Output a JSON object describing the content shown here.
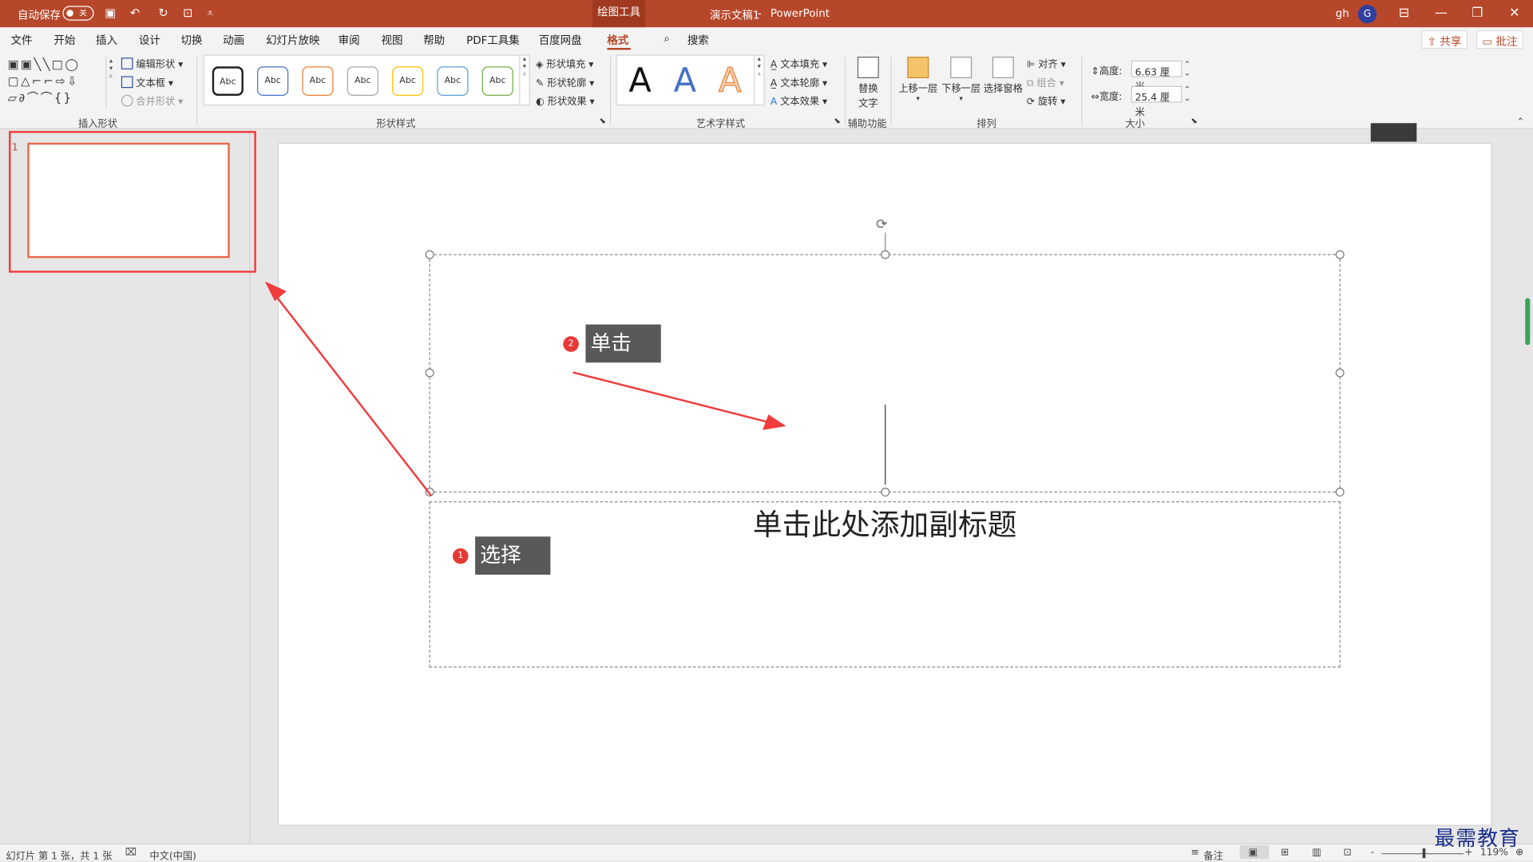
{
  "title_bar": {
    "autosave_label": "自动保存",
    "autosave_state": "关",
    "tool_tab": "绘图工具",
    "document_title": "演示文稿1",
    "separator": "-",
    "app_name": "PowerPoint",
    "user_initials": "gh",
    "avatar_letter": "G"
  },
  "menu": {
    "tabs": [
      "文件",
      "开始",
      "插入",
      "设计",
      "切换",
      "动画",
      "幻灯片放映",
      "审阅",
      "视图",
      "帮助",
      "PDF工具集",
      "百度网盘",
      "格式"
    ],
    "active_tab": "格式",
    "search_label": "搜索",
    "share_label": "共享",
    "comments_label": "批注"
  },
  "ribbon": {
    "insert_shapes": {
      "edit_shape": "编辑形状",
      "text_box": "文本框",
      "merge_shapes": "合并形状",
      "label": "插入形状"
    },
    "shape_styles": {
      "swatch_text": "Abc",
      "swatches": [
        {
          "border": "#222222"
        },
        {
          "border": "#4472c4"
        },
        {
          "border": "#ed7d31"
        },
        {
          "border": "#a5a5a5"
        },
        {
          "border": "#ffc000"
        },
        {
          "border": "#5b9bd5"
        },
        {
          "border": "#70ad47"
        }
      ],
      "fill": "形状填充",
      "outline": "形状轮廓",
      "effects": "形状效果",
      "label": "形状样式"
    },
    "wordart": {
      "letter": "A",
      "colors": [
        "#111111",
        "#4472c4",
        "#ed7d31"
      ],
      "text_fill": "文本填充",
      "text_outline": "文本轮廓",
      "text_effects": "文本效果",
      "label": "艺术字样式"
    },
    "accessibility": {
      "alt_text_line1": "替换",
      "alt_text_line2": "文字",
      "label": "辅助功能"
    },
    "arrange": {
      "bring_forward": "上移一层",
      "send_backward": "下移一层",
      "selection_pane": "选择窗格",
      "align": "对齐",
      "group": "组合",
      "rotate": "旋转",
      "label": "排列"
    },
    "size": {
      "height_label": "高度:",
      "height_value": "6.63 厘米",
      "width_label": "宽度:",
      "width_value": "25.4 厘米",
      "label": "大小"
    }
  },
  "thumbnails": {
    "slide_number": "1"
  },
  "slide": {
    "subtitle_placeholder": "单击此处添加副标题"
  },
  "annotations": [
    {
      "number": "1",
      "text": "选择"
    },
    {
      "number": "2",
      "text": "单击"
    }
  ],
  "status_bar": {
    "slide_info": "幻灯片 第 1 张，共 1 张",
    "language": "中文(中国)",
    "notes": "备注",
    "zoom_minus": "-",
    "zoom_plus": "+",
    "zoom_level": "119%"
  },
  "watermark": "最需教育",
  "colors": {
    "accent": "#b7472a",
    "annotation_red": "#f03c3c"
  }
}
